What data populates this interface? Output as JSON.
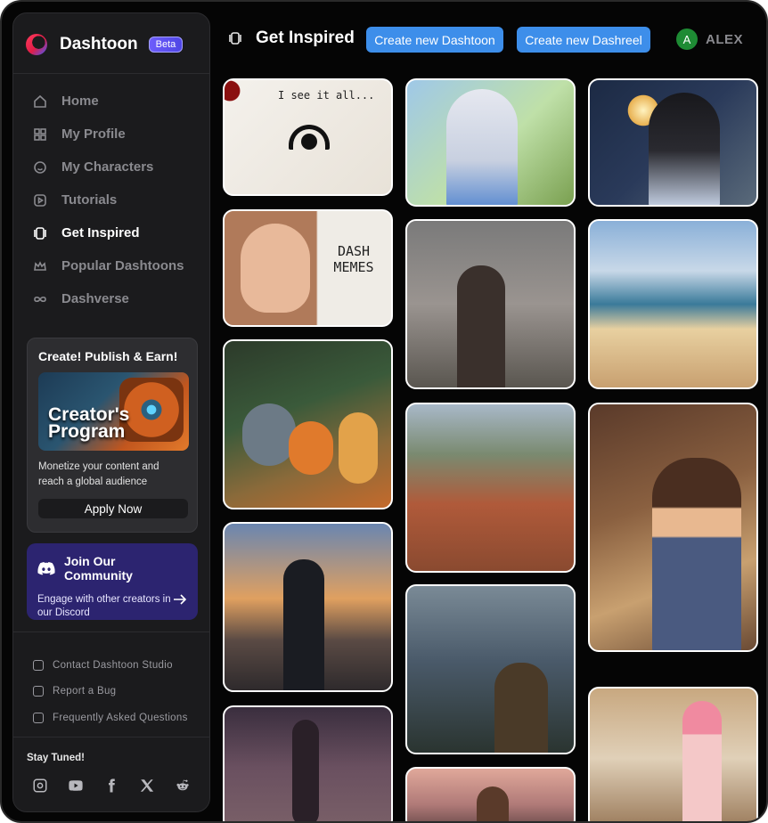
{
  "brand": {
    "name": "Dashtoon",
    "badge": "Beta"
  },
  "nav": [
    {
      "label": "Home",
      "icon": "home-icon",
      "active": false
    },
    {
      "label": "My Profile",
      "icon": "grid-icon",
      "active": false
    },
    {
      "label": "My Characters",
      "icon": "smiley-icon",
      "active": false
    },
    {
      "label": "Tutorials",
      "icon": "play-icon",
      "active": false
    },
    {
      "label": "Get Inspired",
      "icon": "inspire-icon",
      "active": true
    },
    {
      "label": "Popular Dashtoons",
      "icon": "crown-icon",
      "active": false
    },
    {
      "label": "Dashverse",
      "icon": "infinity-icon",
      "active": false
    }
  ],
  "promo": {
    "title": "Create! Publish & Earn!",
    "image_text": "Creator's Program",
    "description": "Monetize your content and reach a global audience",
    "button": "Apply Now"
  },
  "community": {
    "title": "Join Our Community",
    "description": "Engage with other creators in our Discord"
  },
  "links": [
    {
      "label": "Contact Dashtoon Studio",
      "icon": "mail-icon"
    },
    {
      "label": "Report a Bug",
      "icon": "bug-icon"
    },
    {
      "label": "Frequently Asked Questions",
      "icon": "help-icon"
    }
  ],
  "social": {
    "title": "Stay Tuned!",
    "icons": [
      "instagram-icon",
      "youtube-icon",
      "facebook-icon",
      "x-icon",
      "reddit-icon"
    ]
  },
  "header": {
    "title": "Get Inspired",
    "create_dashtoon": "Create new Dashtoon",
    "create_dashreel": "Create new Dashreel",
    "avatar_letter": "A",
    "username": "ALEX"
  },
  "gallery": {
    "tile_texts": {
      "see_it_all": "I see it all...",
      "dash_memes": "DASH MEMES"
    },
    "colors": {
      "accent": "#3d8eea",
      "community": "#2c2470",
      "avatar": "#1e8b34"
    }
  }
}
